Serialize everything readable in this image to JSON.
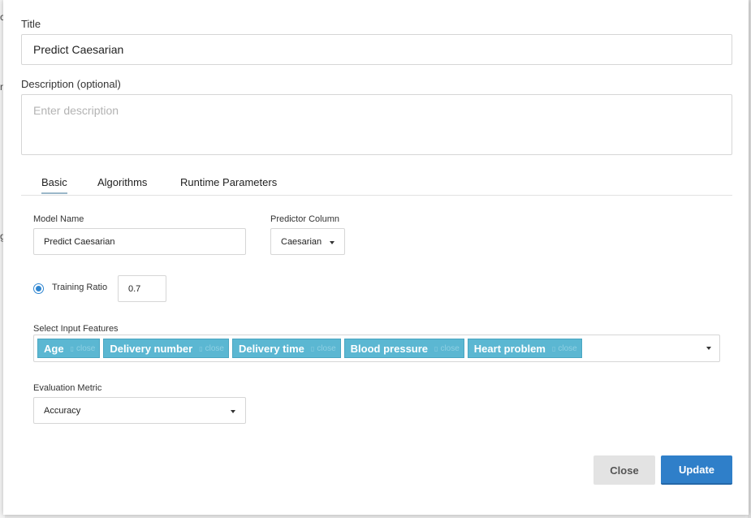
{
  "background": {
    "fragments": [
      "c",
      "n",
      "g"
    ]
  },
  "form": {
    "title_label": "Title",
    "title_value": "Predict Caesarian",
    "description_label": "Description (optional)",
    "description_placeholder": "Enter description"
  },
  "tabs": [
    {
      "label": "Basic",
      "active": true
    },
    {
      "label": "Algorithms",
      "active": false
    },
    {
      "label": "Runtime Parameters",
      "active": false
    }
  ],
  "basic": {
    "model_name_label": "Model Name",
    "model_name_value": "Predict Caesarian",
    "predictor_column_label": "Predictor Column",
    "predictor_column_value": "Caesarian",
    "training_ratio_label": "Training Ratio",
    "training_ratio_value": "0.7",
    "training_ratio_selected": true,
    "input_features_label": "Select Input Features",
    "input_features": [
      {
        "label": "Age",
        "remove": "close"
      },
      {
        "label": "Delivery number",
        "remove": "close"
      },
      {
        "label": "Delivery time",
        "remove": "close"
      },
      {
        "label": "Blood pressure",
        "remove": "close"
      },
      {
        "label": "Heart problem",
        "remove": "close"
      }
    ],
    "evaluation_metric_label": "Evaluation Metric",
    "evaluation_metric_value": "Accuracy"
  },
  "footer": {
    "close_label": "Close",
    "update_label": "Update"
  },
  "colors": {
    "primary": "#2f7fc9",
    "chip": "#5bb7d2",
    "radio": "#2f86d1"
  }
}
